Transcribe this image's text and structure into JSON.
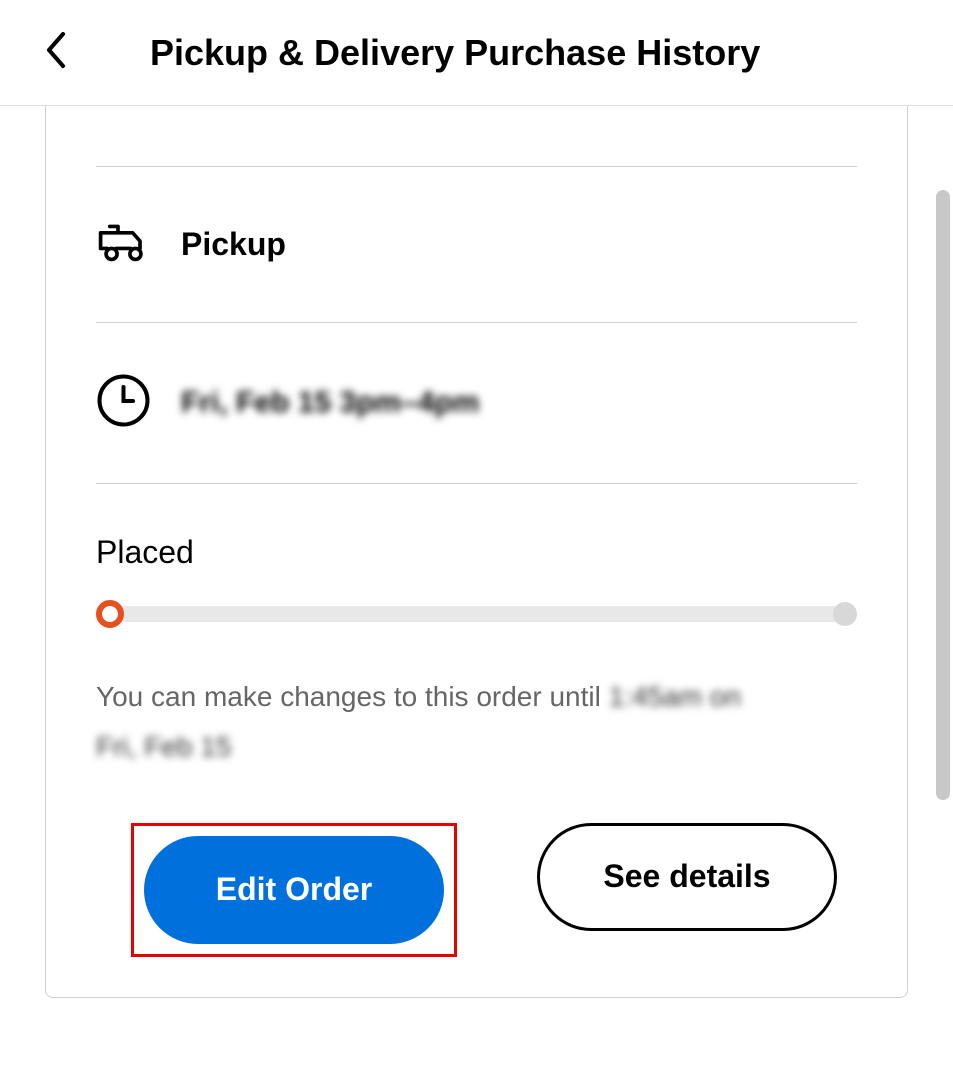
{
  "header": {
    "title": "Pickup & Delivery Purchase History"
  },
  "order": {
    "pickup_label": "Pickup",
    "time_slot": "Fri, Feb 15 3pm–4pm",
    "status_label": "Placed",
    "info_text_prefix": "You can make changes to this order until ",
    "info_redacted_1": "1:45am on",
    "info_redacted_2": "Fri, Feb 15"
  },
  "buttons": {
    "edit_order": "Edit Order",
    "see_details": "See details"
  }
}
